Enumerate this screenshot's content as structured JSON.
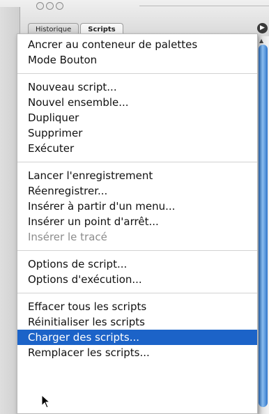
{
  "tabs": [
    "Historique",
    "Scripts"
  ],
  "palette_menu_icon": "triangle-right-icon",
  "menu": {
    "sections": [
      [
        {
          "label": "Ancrer au conteneur de palettes",
          "enabled": true
        },
        {
          "label": "Mode Bouton",
          "enabled": true
        }
      ],
      [
        {
          "label": "Nouveau script...",
          "enabled": true
        },
        {
          "label": "Nouvel ensemble...",
          "enabled": true
        },
        {
          "label": "Dupliquer",
          "enabled": true
        },
        {
          "label": "Supprimer",
          "enabled": true
        },
        {
          "label": "Exécuter",
          "enabled": true
        }
      ],
      [
        {
          "label": "Lancer l'enregistrement",
          "enabled": true
        },
        {
          "label": "Réenregistrer...",
          "enabled": true
        },
        {
          "label": "Insérer à partir d'un menu...",
          "enabled": true
        },
        {
          "label": "Insérer un point d'arrêt...",
          "enabled": true
        },
        {
          "label": "Insérer le tracé",
          "enabled": false
        }
      ],
      [
        {
          "label": "Options de script...",
          "enabled": true
        },
        {
          "label": "Options d'exécution...",
          "enabled": true
        }
      ],
      [
        {
          "label": "Effacer tous les scripts",
          "enabled": true
        },
        {
          "label": "Réinitialiser les scripts",
          "enabled": true
        },
        {
          "label": "Charger des scripts...",
          "enabled": true,
          "selected": true
        },
        {
          "label": "Remplacer les scripts...",
          "enabled": true
        }
      ]
    ]
  },
  "colors": {
    "highlight": "#1c63c8",
    "disabled_text": "#8c8c8c",
    "scroll_thumb": "#2f74c8"
  }
}
